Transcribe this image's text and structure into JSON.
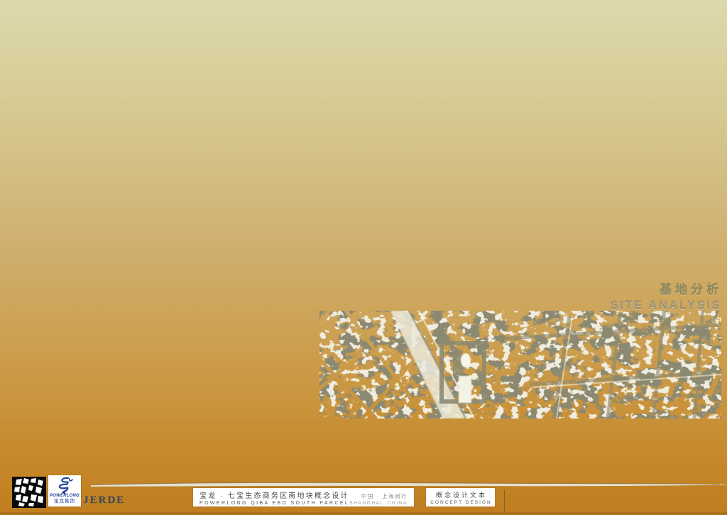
{
  "heading": {
    "title_cn": "基地分析",
    "title_en": "SITE ANALYSIS"
  },
  "map": {
    "description": "duotone aerial photograph of the Qibao site, gray building fabric and white roads over amber ground"
  },
  "footer": {
    "jerde_wordmark": "JERDE",
    "powerlong": {
      "name": "POWERLONG",
      "group_cn": "宝龙集团"
    },
    "project": {
      "title_cn": "宝龙 · 七宝生态商务区南地块概念设计",
      "title_en": "POWERLONG QIBA EBD SOUTH PARCEL",
      "location_cn": "中国 · 上海闵行",
      "location_en": "SHANGHAI, CHINA"
    },
    "doc": {
      "type_cn": "概念设计文本",
      "type_en": "CONCEPT DESIGN"
    }
  },
  "colors": {
    "gradient_top": "#dcd9ac",
    "gradient_bottom": "#bf7d1e",
    "heading_cn": "#8e8a5e",
    "heading_en": "#9d9880",
    "map_gray": "#8c8a70",
    "map_white": "#efeee2",
    "powerlong_blue": "#21409a",
    "jerde_navy": "#3c4a56"
  }
}
